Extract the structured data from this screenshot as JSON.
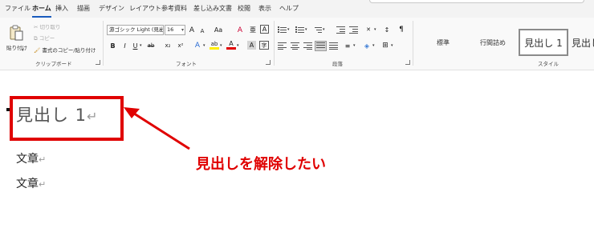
{
  "menu": {
    "tabs": [
      "ファイル",
      "ホーム",
      "挿入",
      "描画",
      "デザイン",
      "レイアウト",
      "参考資料",
      "差し込み文書",
      "校閲",
      "表示",
      "ヘルプ"
    ]
  },
  "clipboard": {
    "paste": "貼り付け",
    "cut": "切り取り",
    "copy": "コピー",
    "format_painter": "書式のコピー/貼り付け",
    "group_label": "クリップボード"
  },
  "font": {
    "font_name": "游ゴシック Light (見出",
    "font_size": "16",
    "grow": "A",
    "shrink": "A",
    "case": "Aa",
    "clear": "A",
    "phonetic": "亜",
    "enclose": "A",
    "bold": "B",
    "italic": "I",
    "underline": "U",
    "strike": "ab",
    "subscript": "x₂",
    "superscript": "x²",
    "effects": "A",
    "highlight": "ab",
    "color": "A",
    "shading": "A",
    "char_border": "字",
    "group_label": "フォント"
  },
  "paragraph": {
    "group_label": "段落"
  },
  "styles": {
    "items": [
      "標準",
      "行間詰め",
      "見出し 1",
      "見出し"
    ],
    "selected_index": 2,
    "group_label": "スタイル"
  },
  "document": {
    "heading": "見出し 1",
    "return_mark": "↵",
    "lines": [
      "文章",
      "文章"
    ]
  },
  "annotation": {
    "text": "見出しを解除したい",
    "color": "#e00000"
  }
}
